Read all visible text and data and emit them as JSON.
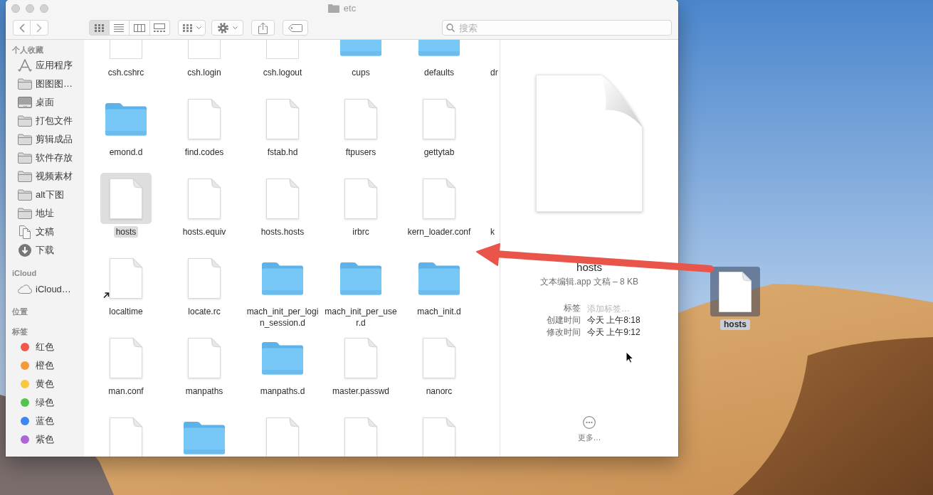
{
  "window": {
    "title": "etc"
  },
  "toolbar": {
    "view_modes": [
      {
        "kind": "icons",
        "selected": true
      },
      {
        "kind": "list",
        "selected": false
      },
      {
        "kind": "columns",
        "selected": false
      },
      {
        "kind": "gallery",
        "selected": false
      }
    ],
    "search": {
      "placeholder": "搜索"
    }
  },
  "sidebar": {
    "sections": [
      {
        "title": "个人收藏",
        "items": [
          {
            "kind": "apps",
            "label": "应用程序"
          },
          {
            "kind": "folder",
            "label": "图图图…"
          },
          {
            "kind": "desktop",
            "label": "桌面"
          },
          {
            "kind": "folder",
            "label": "打包文件"
          },
          {
            "kind": "folder",
            "label": "剪辑成品"
          },
          {
            "kind": "folder",
            "label": "软件存放"
          },
          {
            "kind": "folder",
            "label": "视频素材"
          },
          {
            "kind": "folder",
            "label": "alt下图"
          },
          {
            "kind": "folder",
            "label": "地址"
          },
          {
            "kind": "documents",
            "label": "文稿"
          },
          {
            "kind": "downloads",
            "label": "下载"
          }
        ]
      },
      {
        "title": "iCloud",
        "items": [
          {
            "kind": "cloud",
            "label": "iCloud…"
          }
        ]
      },
      {
        "title": "位置"
      },
      {
        "title": "标签",
        "items": [
          {
            "kind": "tag",
            "label": "红色",
            "color": "#f1574b"
          },
          {
            "kind": "tag",
            "label": "橙色",
            "color": "#f39a3a"
          },
          {
            "kind": "tag",
            "label": "黄色",
            "color": "#f6c940"
          },
          {
            "kind": "tag",
            "label": "绿色",
            "color": "#55c44f"
          },
          {
            "kind": "tag",
            "label": "蓝色",
            "color": "#3d88f0"
          },
          {
            "kind": "tag",
            "label": "紫色",
            "color": "#ad66da"
          }
        ]
      }
    ]
  },
  "grid": {
    "rows": [
      {
        "items": [
          {
            "kind": "file",
            "name": "csh.cshrc",
            "selected": false
          },
          {
            "kind": "file",
            "name": "csh.login",
            "selected": false
          },
          {
            "kind": "file",
            "name": "csh.logout",
            "selected": false
          },
          {
            "kind": "folder",
            "name": "cups",
            "selected": false
          },
          {
            "kind": "folder",
            "name": "defaults",
            "selected": false
          },
          {
            "kind": "partial",
            "name": "dr",
            "selected": false
          }
        ]
      },
      {
        "items": [
          {
            "kind": "folder",
            "name": "emond.d",
            "selected": false
          },
          {
            "kind": "file",
            "name": "find.codes",
            "selected": false
          },
          {
            "kind": "file",
            "name": "fstab.hd",
            "selected": false
          },
          {
            "kind": "file",
            "name": "ftpusers",
            "selected": false
          },
          {
            "kind": "file",
            "name": "gettytab",
            "selected": false
          }
        ]
      },
      {
        "items": [
          {
            "kind": "file",
            "name": "hosts",
            "selected": true
          },
          {
            "kind": "file",
            "name": "hosts.equiv",
            "selected": false
          },
          {
            "kind": "file",
            "name": "hosts.hosts",
            "selected": false
          },
          {
            "kind": "file",
            "name": "irbrc",
            "selected": false
          },
          {
            "kind": "file",
            "name": "kern_loader.conf",
            "selected": false
          },
          {
            "kind": "partial",
            "name": "k",
            "selected": false
          }
        ]
      },
      {
        "items": [
          {
            "kind": "alias",
            "name": "localtime",
            "selected": false
          },
          {
            "kind": "file",
            "name": "locate.rc",
            "selected": false
          },
          {
            "kind": "folder",
            "name": "mach_init_per_login_session.d",
            "selected": false
          },
          {
            "kind": "folder",
            "name": "mach_init_per_user.d",
            "selected": false
          },
          {
            "kind": "folder",
            "name": "mach_init.d",
            "selected": false
          }
        ]
      },
      {
        "items": [
          {
            "kind": "file",
            "name": "man.conf",
            "selected": false
          },
          {
            "kind": "file",
            "name": "manpaths",
            "selected": false
          },
          {
            "kind": "folder",
            "name": "manpaths.d",
            "selected": false
          },
          {
            "kind": "file",
            "name": "master.passwd",
            "selected": false
          },
          {
            "kind": "file",
            "name": "nanorc",
            "selected": false
          }
        ]
      },
      {
        "items": [
          {
            "kind": "file",
            "selected": false
          },
          {
            "kind": "folder",
            "selected": false
          },
          {
            "kind": "file",
            "selected": false
          },
          {
            "kind": "file",
            "selected": false
          },
          {
            "kind": "file",
            "selected": false
          }
        ]
      }
    ]
  },
  "preview": {
    "name": "hosts",
    "subtitle": "文本编辑.app 文稿 – 8 KB",
    "fields": [
      {
        "kind": "tags",
        "label": "标签",
        "placeholder": "添加标签…"
      },
      {
        "kind": "text",
        "label": "创建时间",
        "value": "今天 上午8:18"
      },
      {
        "kind": "text",
        "label": "修改时间",
        "value": "今天 上午9:12"
      }
    ],
    "more": "更多…"
  },
  "desktop": {
    "icons": [
      {
        "name": "hosts",
        "selected": true
      }
    ]
  }
}
